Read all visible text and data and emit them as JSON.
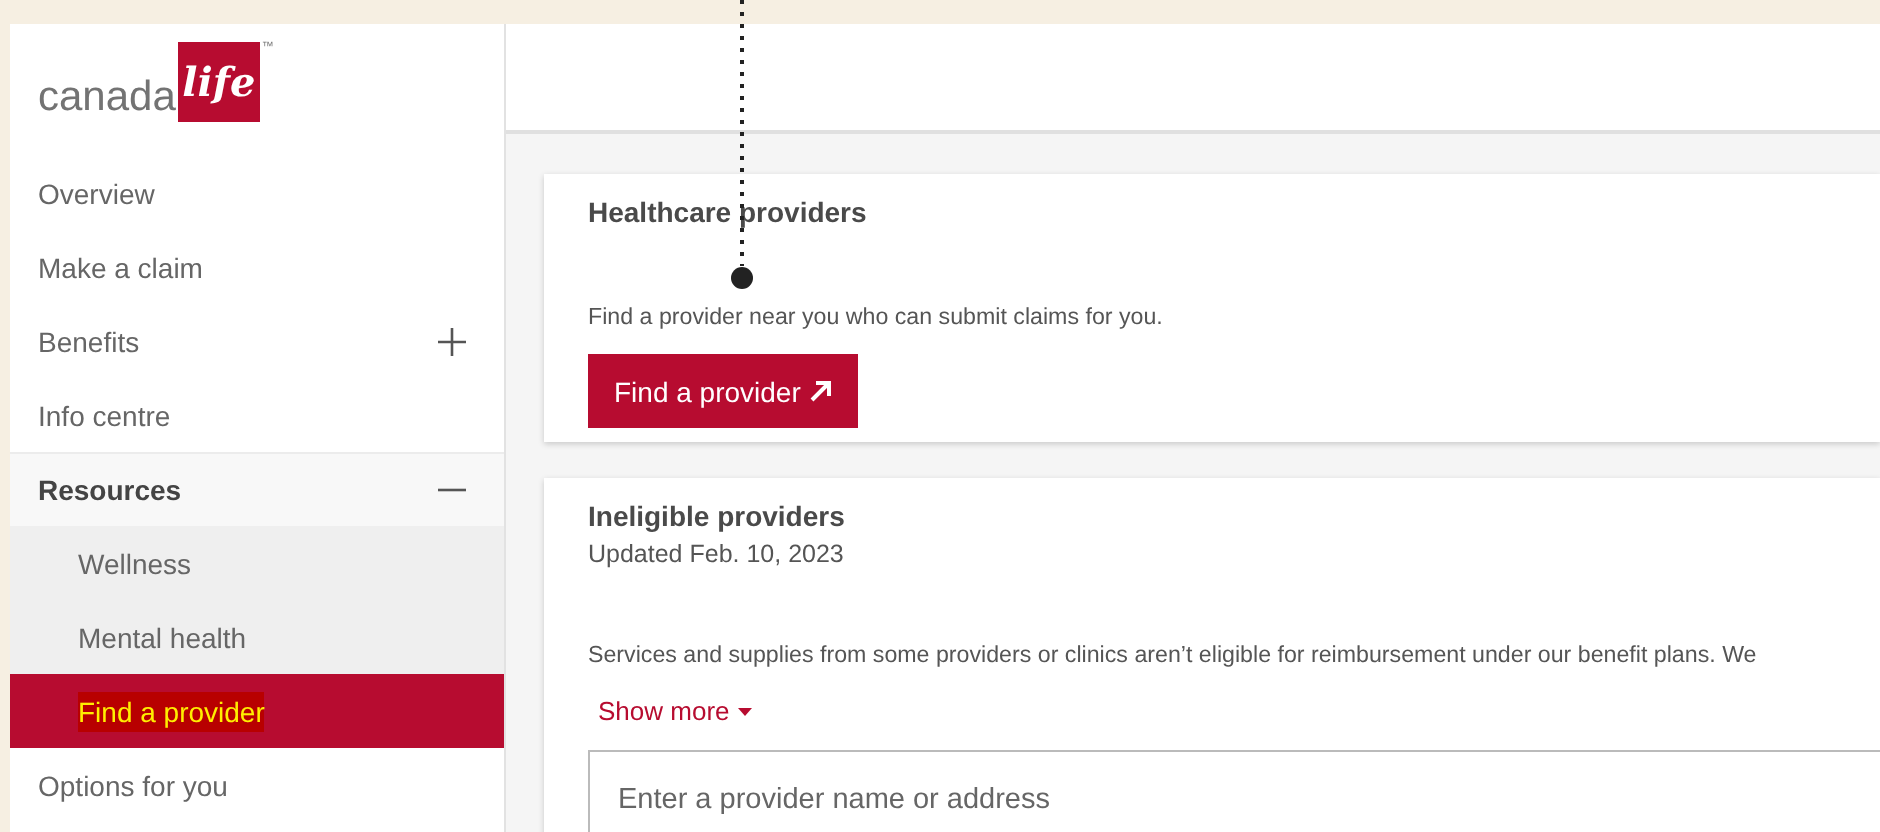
{
  "logo": {
    "word": "canada",
    "mark": "life",
    "trademark": "™"
  },
  "sidebar": {
    "items": [
      {
        "label": "Overview",
        "selected": false
      },
      {
        "label": "Make a claim",
        "selected": false
      },
      {
        "label": "Benefits",
        "selected": false,
        "expanded": false
      },
      {
        "label": "Info centre",
        "selected": false
      },
      {
        "label": "Resources",
        "selected": false,
        "expanded": true,
        "children": [
          {
            "label": "Wellness",
            "selected": false
          },
          {
            "label": "Mental health",
            "selected": false
          },
          {
            "label": "Find a provider",
            "selected": true
          }
        ]
      },
      {
        "label": "Options for you",
        "selected": false
      }
    ]
  },
  "cards": [
    {
      "kind": "action",
      "title": "Healthcare providers",
      "text": "Find a provider near you who can submit claims for you.",
      "button": "Find a provider"
    },
    {
      "kind": "search",
      "title": "Ineligible providers",
      "subtitle": "Updated Feb. 10, 2023",
      "text": "Services and supplies from some providers or clinics aren’t eligible for reimbursement under our benefit plans. We",
      "link": "Show more",
      "search": {
        "placeholder": "Enter a provider name or address"
      }
    }
  ]
}
